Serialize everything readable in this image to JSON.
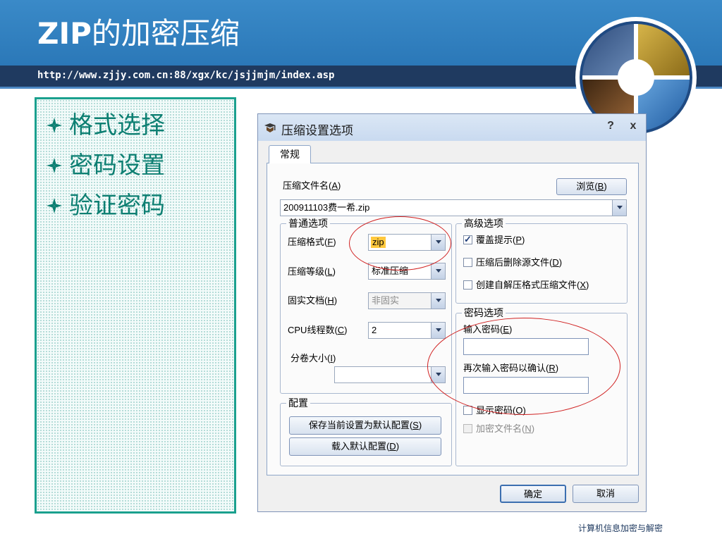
{
  "slide": {
    "title_prefix": "ZIP",
    "title_suffix": "的加密压缩",
    "url": "http://www.zjjy.com.cn:88/xgx/kc/jsjjmjm/index.asp",
    "bullets": [
      "格式选择",
      "密码设置",
      "验证密码"
    ],
    "footer": "计算机信息加密与解密"
  },
  "dialog": {
    "title": "压缩设置选项",
    "help": "?",
    "close": "x",
    "tab": "常规",
    "archive_name_label": "压缩文件名(",
    "archive_name_key": "A",
    "browse_label": "浏览(",
    "browse_key": "B",
    "archive_name_value": "200911103费一希.zip",
    "general": {
      "title": "普通选项",
      "format_label": "压缩格式(",
      "format_key": "F",
      "format_value": "zip",
      "level_label": "压缩等级(",
      "level_key": "L",
      "level_value": "标准压缩",
      "solid_label": "固实文档(",
      "solid_key": "H",
      "solid_value": "非固实",
      "threads_label": "CPU线程数(",
      "threads_key": "C",
      "threads_value": "2",
      "volume_label": "分卷大小(",
      "volume_key": "I",
      "volume_value": ""
    },
    "config": {
      "title": "配置",
      "save_label": "保存当前设置为默认配置(",
      "save_key": "S",
      "load_label": "载入默认配置(",
      "load_key": "D"
    },
    "advanced": {
      "title": "高级选项",
      "overwrite_label": "覆盖提示(",
      "overwrite_key": "P",
      "overwrite_checked": true,
      "delete_label": "压缩后删除源文件(",
      "delete_key": "D",
      "delete_checked": false,
      "sfx_label": "创建自解压格式压缩文件(",
      "sfx_key": "X",
      "sfx_checked": false
    },
    "password": {
      "title": "密码选项",
      "enter_label": "输入密码(",
      "enter_key": "E",
      "confirm_label": "再次输入密码以确认(",
      "confirm_key": "R",
      "show_label": "显示密码(",
      "show_key": "O",
      "show_checked": false,
      "encrypt_names_label": "加密文件名(",
      "encrypt_names_key": "N",
      "encrypt_names_checked": false
    },
    "ok_label": "确定",
    "cancel_label": "取消"
  },
  "colors": {
    "header_blue": "#2f80c0",
    "header_dark": "#1f3a60",
    "bullet_teal": "#0d7f72",
    "panel_border": "#1aa08e",
    "annotation_red": "#d02020",
    "format_highlight": "#ffc83d"
  },
  "icons": [
    "star-bullet-icon",
    "logo-globe-icon",
    "app-icon",
    "dropdown-arrow-icon",
    "checkbox-icon"
  ]
}
